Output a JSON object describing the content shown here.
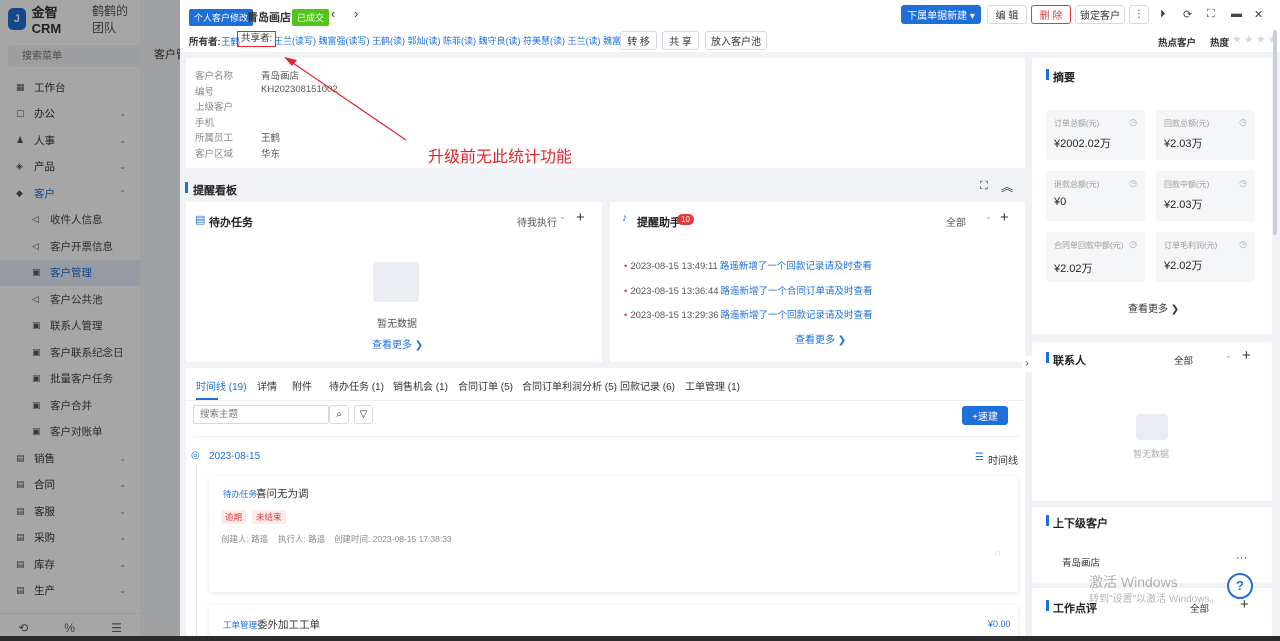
{
  "app": {
    "brand": "金智CRM",
    "team": "鹤鹤的团队",
    "search_placeholder": "搜索菜单"
  },
  "menu": [
    {
      "label": "工作台",
      "icon": "▦",
      "type": "top"
    },
    {
      "label": "办公",
      "icon": "▢",
      "type": "top",
      "chev": "⌄"
    },
    {
      "label": "人事",
      "icon": "♟",
      "type": "top",
      "chev": "⌄"
    },
    {
      "label": "产品",
      "icon": "◈",
      "type": "top",
      "chev": "⌄"
    },
    {
      "label": "客户",
      "icon": "◆",
      "type": "open",
      "chev": "⌃"
    },
    {
      "label": "收件人信息",
      "icon": "◁",
      "type": "sub"
    },
    {
      "label": "客户开票信息",
      "icon": "◁",
      "type": "sub"
    },
    {
      "label": "客户管理",
      "icon": "▣",
      "type": "active"
    },
    {
      "label": "客户公共池",
      "icon": "◁",
      "type": "sub"
    },
    {
      "label": "联系人管理",
      "icon": "▣",
      "type": "sub"
    },
    {
      "label": "客户联系纪念日",
      "icon": "▣",
      "type": "sub"
    },
    {
      "label": "批量客户任务",
      "icon": "▣",
      "type": "sub"
    },
    {
      "label": "客户合并",
      "icon": "▣",
      "type": "sub"
    },
    {
      "label": "客户对账单",
      "icon": "▣",
      "type": "sub"
    },
    {
      "label": "销售",
      "icon": "▤",
      "type": "top",
      "chev": "⌄"
    },
    {
      "label": "合同",
      "icon": "▤",
      "type": "top",
      "chev": "⌄"
    },
    {
      "label": "客服",
      "icon": "▤",
      "type": "top",
      "chev": "⌄"
    },
    {
      "label": "采购",
      "icon": "▤",
      "type": "top",
      "chev": "⌄"
    },
    {
      "label": "库存",
      "icon": "▤",
      "type": "top",
      "chev": "⌄"
    },
    {
      "label": "生产",
      "icon": "▤",
      "type": "top",
      "chev": "⌄"
    }
  ],
  "bg": {
    "title": "客户管"
  },
  "header": {
    "tag1": "个人客户修改",
    "customer": "青岛画店",
    "tag2": "已成交",
    "btn_new": "下属单据新建 ▾",
    "btn_edit": "编 辑",
    "btn_delete": "删 除",
    "btn_lock": "锁定客户",
    "more": "⋮"
  },
  "owners": {
    "owner_label": "所有者:",
    "owner_name": "王鹤",
    "shared_label": "共享者:",
    "shared_names": "王兰(读写) 魏富强(读写) 王鹤(读) 郭灿(读) 陈菲(读) 魏守良(读) 符美慧(读) 王兰(读) 魏富强(读)",
    "btn_transfer": "转 移",
    "btn_share": "共 享",
    "btn_pool": "放入客户池",
    "hot_label": "热点客户",
    "heat_label": "热度",
    "stars": "★★★★"
  },
  "info": {
    "rows": [
      {
        "label": "客户名称",
        "value": "青岛画店"
      },
      {
        "label": "编号",
        "value": "KH202308151002"
      },
      {
        "label": "上级客户",
        "value": ""
      },
      {
        "label": "手机",
        "value": ""
      },
      {
        "label": "所属员工",
        "value": "王鹤"
      },
      {
        "label": "客户区域",
        "value": "华东"
      }
    ]
  },
  "annotation": "升级前无此统计功能",
  "reminder_board": {
    "title": "提醒看板"
  },
  "todo": {
    "title": "待办任务",
    "filter": "待我执行",
    "empty": "暂无数据",
    "more": "查看更多 ❯"
  },
  "helper": {
    "title": "提醒助手",
    "badge": "10",
    "filter": "全部",
    "more": "查看更多 ❯",
    "items": [
      {
        "time": "2023-08-15 13:49:11",
        "text": "路遥新增了一个回款记录请及时查看"
      },
      {
        "time": "2023-08-15 13:36:44",
        "text": "路遥新增了一个合同订单请及时查看"
      },
      {
        "time": "2023-08-15 13:29:36",
        "text": "路遥新增了一个回款记录请及时查看"
      }
    ]
  },
  "tabs": [
    "时间线 (19)",
    "详情",
    "附件",
    "待办任务 (1)",
    "销售机会 (1)",
    "合同订单 (5)",
    "合同订单利润分析 (5)",
    "回款记录 (6)",
    "工单管理 (1)"
  ],
  "timeline": {
    "search_placeholder": "搜索主题",
    "quick_new": "+速建",
    "date": "2023-08-15",
    "view": "时间线",
    "item1": {
      "type": "待办任务",
      "title": "喜问无为调",
      "chip1": "逾期",
      "chip2": "未结束",
      "creator": "创建人: 路遥",
      "executor": "执行人: 路遥",
      "created": "创建时间: 2023-08-15 17:38:33"
    },
    "item2": {
      "type": "工单管理",
      "title": "委外加工工单",
      "amount": "¥0.00"
    }
  },
  "summary": {
    "title": "摘要",
    "more": "查看更多 ❯",
    "cards": [
      {
        "label": "订单总额(元)",
        "value": "¥2002.02万"
      },
      {
        "label": "回款总额(元)",
        "value": "¥2.03万"
      },
      {
        "label": "退款总额(元)",
        "value": "¥0"
      },
      {
        "label": "回款中额(元)",
        "value": "¥2.03万"
      },
      {
        "label": "合同单回款中额(元)",
        "value": "¥2.02万"
      },
      {
        "label": "订单毛利润(元)",
        "value": "¥2.02万"
      }
    ]
  },
  "contacts": {
    "title": "联系人",
    "filter": "全部",
    "empty": "暂无数据"
  },
  "relations": {
    "title": "上下级客户",
    "item": "青岛画店",
    "more": "···"
  },
  "review": {
    "title": "工作点评",
    "filter": "全部"
  },
  "watermark": {
    "line1": "激活 Windows",
    "line2": "转到\"设置\"以激活 Windows。"
  },
  "colors": {
    "accent": "#1e6fd9",
    "danger": "#e03a3a",
    "success": "#52c41a",
    "annotation": "#e0262c"
  }
}
